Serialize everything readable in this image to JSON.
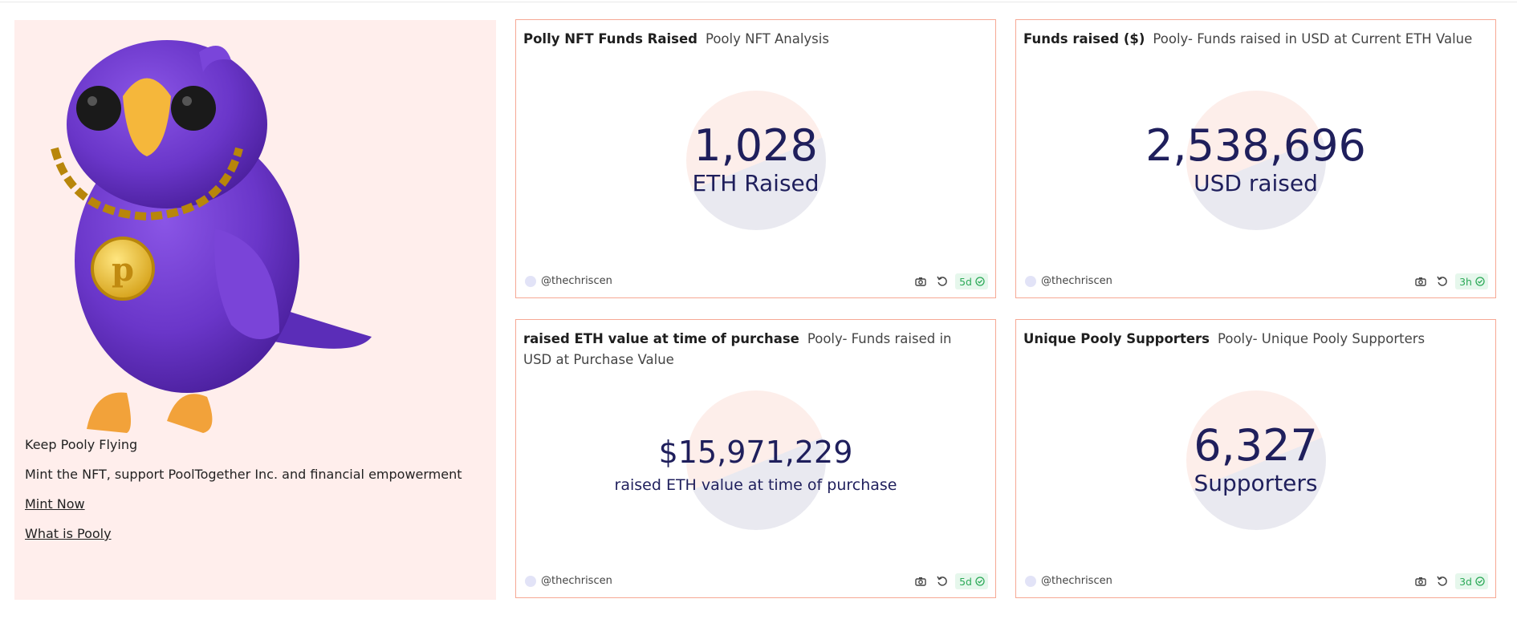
{
  "hero": {
    "title": "Keep Pooly Flying",
    "subtitle": "Mint the NFT, support PoolTogether Inc. and financial empowerment",
    "link_mint": "Mint Now",
    "link_about": "What is Pooly",
    "bg_color": "#ffeeec"
  },
  "cards": [
    {
      "title": "Polly NFT Funds Raised",
      "subtitle": "Pooly NFT Analysis",
      "value": "1,028",
      "label": "ETH Raised",
      "author": "@thechriscen",
      "age": "5d"
    },
    {
      "title": "Funds raised ($)",
      "subtitle": "Pooly- Funds raised in USD at Current ETH Value",
      "value": "2,538,696",
      "label": "USD raised",
      "author": "@thechriscen",
      "age": "3h"
    },
    {
      "title": "raised ETH value at time of purchase",
      "subtitle": "Pooly- Funds raised in USD at Purchase Value",
      "value": "$15,971,229",
      "label": "raised ETH value at time of purchase",
      "author": "@thechriscen",
      "age": "5d"
    },
    {
      "title": "Unique Pooly Supporters",
      "subtitle": "Pooly- Unique Pooly Supporters",
      "value": "6,327",
      "label": "Supporters",
      "author": "@thechriscen",
      "age": "3d"
    }
  ],
  "colors": {
    "card_border": "#f6a894",
    "value_text": "#1f1f5c",
    "badge_green": "#2ba957",
    "bird_purple": "#6a36c9"
  },
  "icons": [
    "camera-icon",
    "refresh-icon",
    "check-circle-icon"
  ]
}
